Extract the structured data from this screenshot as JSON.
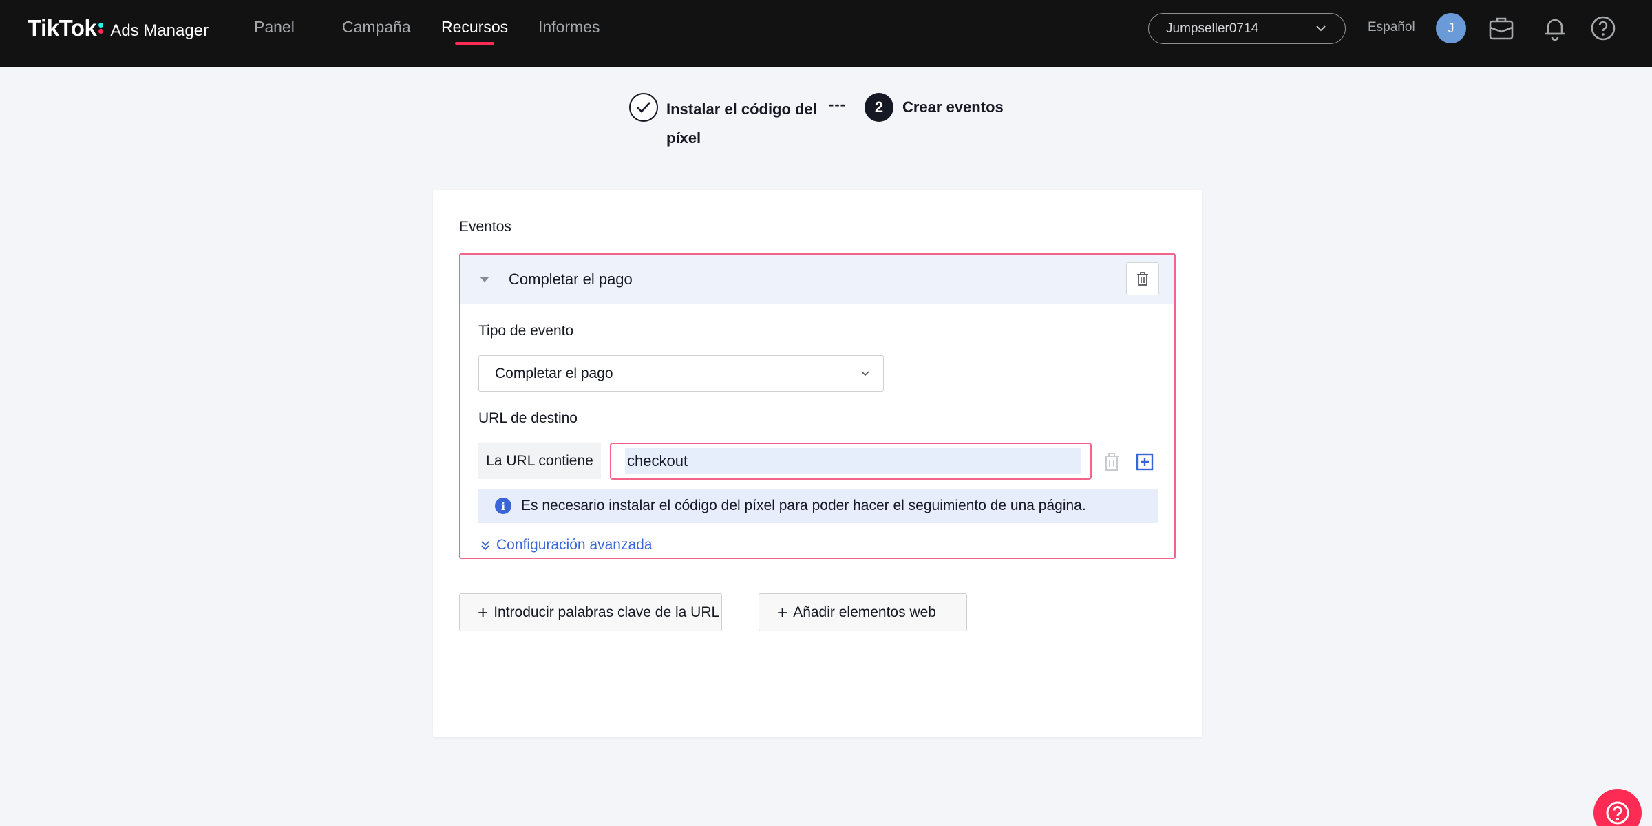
{
  "header": {
    "brand": "TikTok",
    "product": "Ads Manager",
    "nav": [
      {
        "label": "Panel"
      },
      {
        "label": "Campaña"
      },
      {
        "label": "Recursos"
      },
      {
        "label": "Informes"
      }
    ],
    "active_nav": "Recursos",
    "account": "Jumpseller0714",
    "language": "Español",
    "avatar_initial": "J",
    "icons": [
      "briefcase-icon",
      "bell-icon",
      "help-icon"
    ]
  },
  "stepper": {
    "step1_label": "Instalar el código del píxel",
    "separator": "---",
    "step2_number": "2",
    "step2_label": "Crear eventos"
  },
  "events": {
    "section_title": "Eventos",
    "event_name": "Completar el pago",
    "event_type_label": "Tipo de evento",
    "event_type_value": "Completar el pago",
    "url_label": "URL de destino",
    "url_rule": "La URL contiene",
    "url_value": "checkout",
    "info_text": "Es necesario instalar el código del píxel para poder hacer el seguimiento de una página.",
    "advanced_link": "Configuración avanzada"
  },
  "actions": {
    "add_url_keywords": "Introducir palabras clave de la URL",
    "add_web_elements": "Añadir elementos web"
  },
  "colors": {
    "accent": "#fe2c55",
    "link": "#3a65d8",
    "error_border": "#f2648a",
    "topbar": "#121212"
  }
}
